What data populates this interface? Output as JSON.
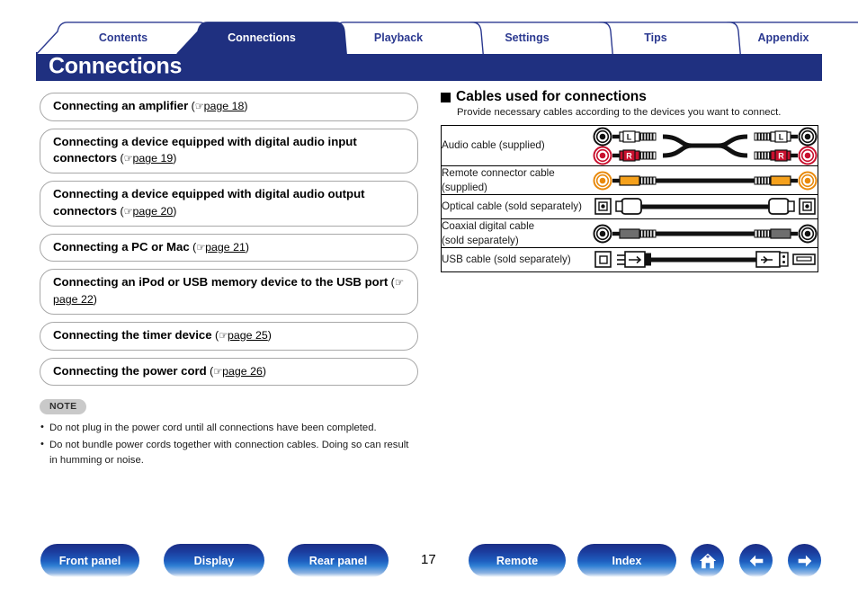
{
  "tabs": [
    {
      "label": "Contents",
      "active": false
    },
    {
      "label": "Connections",
      "active": true
    },
    {
      "label": "Playback",
      "active": false
    },
    {
      "label": "Settings",
      "active": false
    },
    {
      "label": "Tips",
      "active": false
    },
    {
      "label": "Appendix",
      "active": false
    }
  ],
  "header": {
    "title": "Connections",
    "bar_color": "#1f3080",
    "tab_text_color": "#2b3990"
  },
  "left_column": {
    "links": [
      {
        "title": "Connecting an amplifier",
        "page_label": "page 18"
      },
      {
        "title": "Connecting a device equipped with digital audio input connectors",
        "page_label": "page 19"
      },
      {
        "title": "Connecting a device equipped with digital audio output connectors",
        "page_label": "page 20"
      },
      {
        "title": "Connecting a PC or Mac",
        "page_label": "page 21"
      },
      {
        "title": "Connecting an iPod or USB memory device to the USB port",
        "page_label": "page 22"
      },
      {
        "title": "Connecting the timer device",
        "page_label": "page 25"
      },
      {
        "title": "Connecting the power cord",
        "page_label": "page 26"
      }
    ],
    "note": {
      "badge": "NOTE",
      "items": [
        "Do not plug in the power cord until all connections have been completed.",
        "Do not bundle power cords together with connection cables. Doing so can result in humming or noise."
      ]
    }
  },
  "right_column": {
    "heading": "Cables used for connections",
    "subtext": "Provide necessary cables according to the devices you want to connect.",
    "table": {
      "rows": [
        {
          "label": "Audio cable (supplied)",
          "diagram": "rca-stereo-pair"
        },
        {
          "label": "Remote connector cable (supplied)",
          "diagram": "rca-mono-orange"
        },
        {
          "label": "Optical cable (sold separately)",
          "diagram": "optical-toslink"
        },
        {
          "label": "Coaxial digital cable (sold separately)",
          "diagram": "rca-mono-gray"
        },
        {
          "label": "USB cable (sold separately)",
          "diagram": "usb-a-to-b"
        }
      ]
    }
  },
  "bottom_bar": {
    "buttons": [
      {
        "label": "Front panel"
      },
      {
        "label": "Display"
      },
      {
        "label": "Rear panel"
      },
      {
        "label": "Remote"
      },
      {
        "label": "Index"
      }
    ],
    "page_number": "17",
    "icons": [
      "home-icon",
      "arrow-left-icon",
      "arrow-right-icon"
    ],
    "accent_color": "#1b3b9c"
  }
}
